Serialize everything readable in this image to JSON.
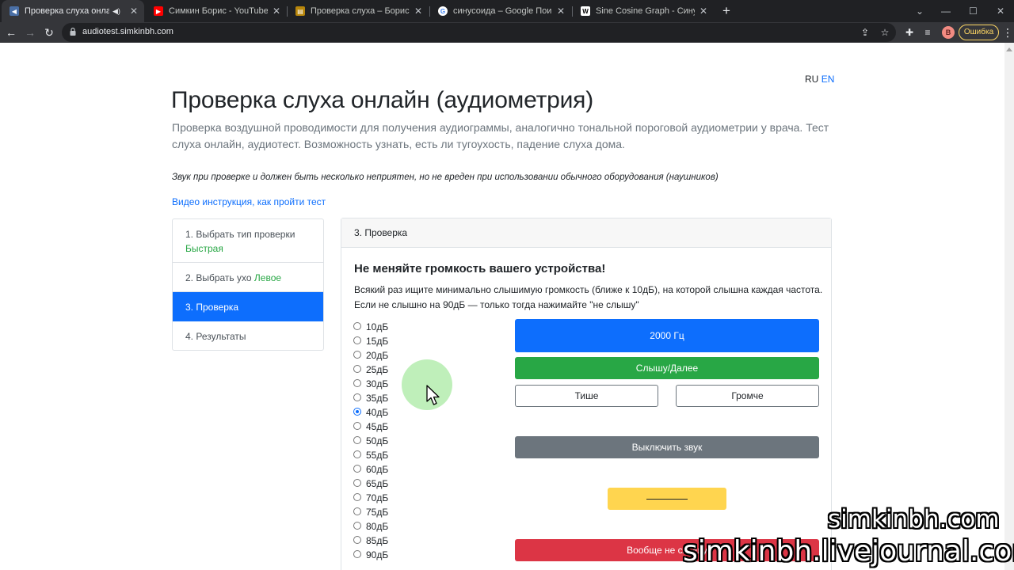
{
  "browser": {
    "tabs": [
      {
        "title": "Проверка слуха онлайн (ау",
        "favicon": "speaker-favicon-icon",
        "audio": true
      },
      {
        "title": "Симкин Борис - YouTube",
        "favicon": "youtube-favicon-icon",
        "audio": false
      },
      {
        "title": "Проверка слуха – Борис Симкин",
        "favicon": "blog-favicon-icon",
        "audio": false
      },
      {
        "title": "синусоида – Google Поиск",
        "favicon": "google-favicon-icon",
        "audio": false
      },
      {
        "title": "Sine Cosine Graph - Синусоида",
        "favicon": "wikipedia-favicon-icon",
        "audio": false
      }
    ],
    "url": "audiotest.simkinbh.com",
    "profile_initial": "B",
    "error_label": "Ошибка"
  },
  "page": {
    "lang": {
      "ru": "RU",
      "en": "EN"
    },
    "title": "Проверка слуха онлайн (аудиометрия)",
    "lead": "Проверка воздушной проводимости для получения аудиограммы, аналогично тональной пороговой аудиометрии у врача. Тест слуха онлайн, аудиотест. Возможность узнать, есть ли тугоухость, падение слуха дома.",
    "warning": "Звук при проверке и должен быть несколько неприятен, но не вреден при использовании обычного оборудования (наушников)",
    "video_link": "Видео инструкция, как пройти тест",
    "steps": {
      "step1_label": "1. Выбрать тип проверки",
      "step1_value": "Быстрая",
      "step2_label": "2. Выбрать ухо",
      "step2_value": "Левое",
      "step3_label": "3. Проверка",
      "step4_label": "4. Результаты"
    },
    "card": {
      "header": "3. Проверка",
      "heading": "Не меняйте громкость вашего устройства!",
      "instructions_line1": "Всякий раз ищите минимально слышимую громкость (ближе к 10дБ), на которой слышна каждая частота.",
      "instructions_line2": "Если не слышно на 90дБ — только тогда нажимайте \"не слышу\"",
      "levels": [
        "10дБ",
        "15дБ",
        "20дБ",
        "25дБ",
        "30дБ",
        "35дБ",
        "40дБ",
        "45дБ",
        "50дБ",
        "55дБ",
        "60дБ",
        "65дБ",
        "70дБ",
        "75дБ",
        "80дБ",
        "85дБ",
        "90дБ"
      ],
      "selected_level": "40дБ",
      "frequency_button": "2000 Гц",
      "hear_button": "Слышу/Далее",
      "quieter_button": "Тише",
      "louder_button": "Громче",
      "mute_button": "Выключить звук",
      "never_hear_button": "Вообще не слышу"
    }
  },
  "watermark": {
    "line1": "simkinbh.com",
    "line2": "simkinbh.livejournal.com"
  },
  "colors": {
    "primary": "#0d6efd",
    "success": "#28a745",
    "secondary": "#6c757d",
    "warning": "#ffd54f",
    "danger": "#dc3545"
  }
}
